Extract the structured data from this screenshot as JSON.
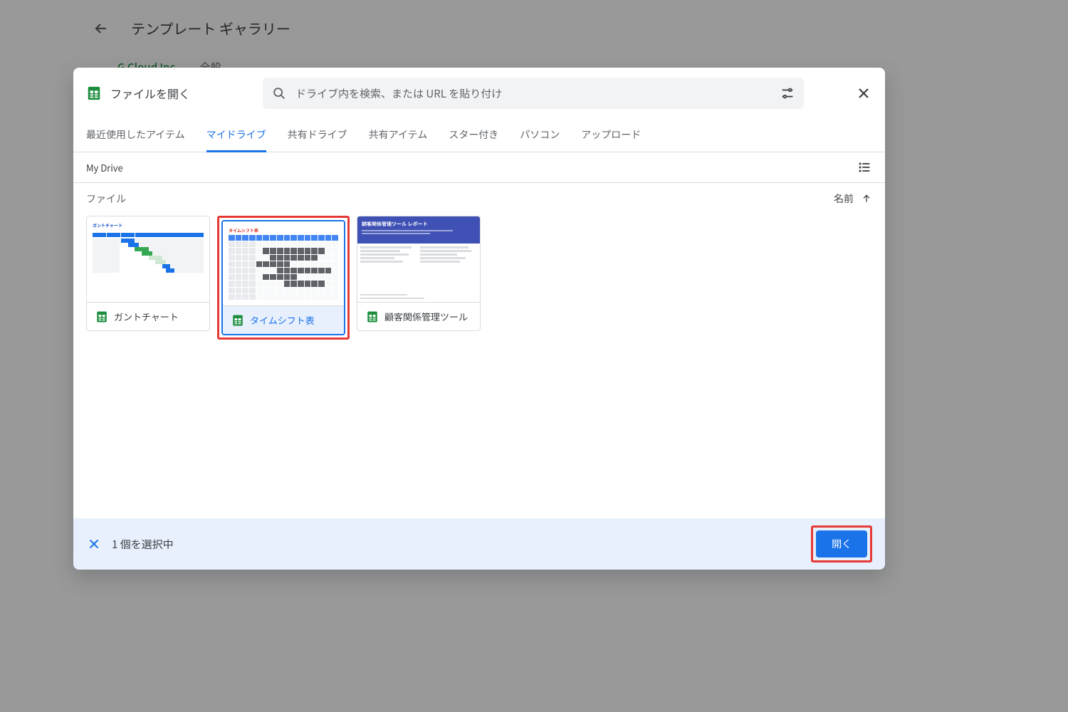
{
  "background": {
    "title": "テンプレート ギャラリー",
    "org_tab": "G Cloud Inc.",
    "general_tab": "全般"
  },
  "dialog": {
    "title": "ファイルを開く",
    "search_placeholder": "ドライブ内を検索、または URL を貼り付け",
    "tabs": [
      {
        "label": "最近使用したアイテム"
      },
      {
        "label": "マイドライブ",
        "active": true
      },
      {
        "label": "共有ドライブ"
      },
      {
        "label": "共有アイテム"
      },
      {
        "label": "スター付き"
      },
      {
        "label": "パソコン"
      },
      {
        "label": "アップロード"
      }
    ],
    "location": "My Drive",
    "section_label": "ファイル",
    "sort_label": "名前",
    "files": [
      {
        "name": "ガントチャート",
        "thumb_title": "ガントチャート",
        "selected": false
      },
      {
        "name": "タイムシフト表",
        "thumb_title": "タイムシフト表",
        "selected": true
      },
      {
        "name": "顧客関係管理ツール",
        "thumb_banner": "顧客関係管理ツール レポート",
        "selected": false
      }
    ],
    "selection_count_text": "1 個を選択中",
    "open_button": "開く"
  }
}
